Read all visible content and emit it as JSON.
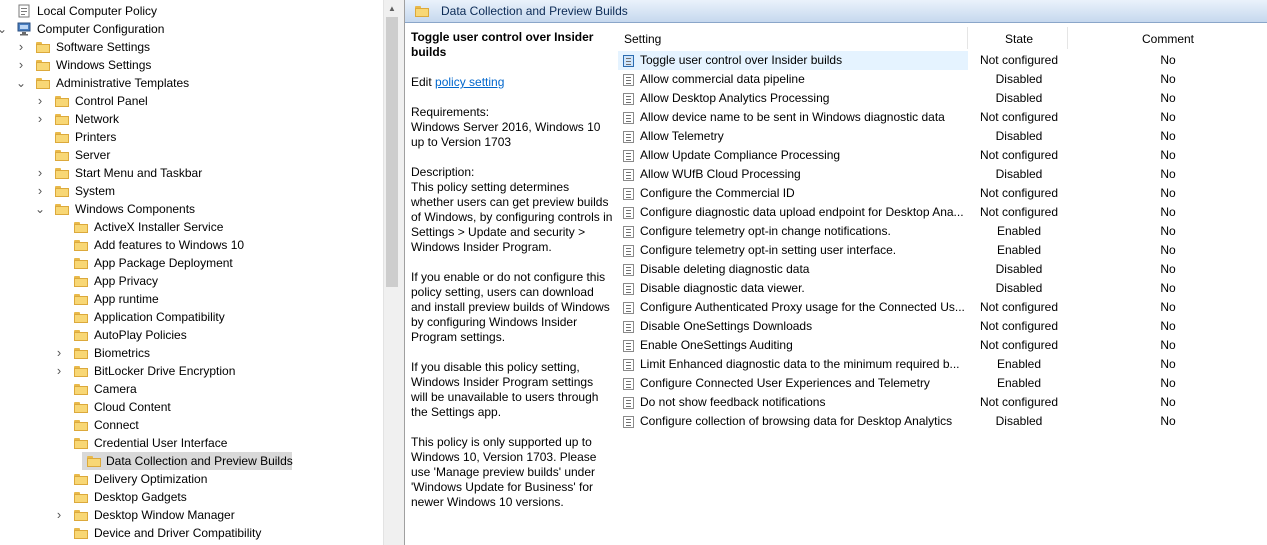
{
  "tree": {
    "items": [
      {
        "label": "Local Computer Policy",
        "level": 0,
        "expander": "none",
        "icon": "computer-policy-icon"
      },
      {
        "label": "Computer Configuration",
        "level": 0,
        "expander": "expanded",
        "icon": "computer-icon"
      },
      {
        "label": "Software Settings",
        "level": 1,
        "expander": "collapsed",
        "icon": "folder-icon"
      },
      {
        "label": "Windows Settings",
        "level": 1,
        "expander": "collapsed",
        "icon": "folder-icon"
      },
      {
        "label": "Administrative Templates",
        "level": 1,
        "expander": "expanded",
        "icon": "folder-icon"
      },
      {
        "label": "Control Panel",
        "level": 2,
        "expander": "collapsed",
        "icon": "folder-icon"
      },
      {
        "label": "Network",
        "level": 2,
        "expander": "collapsed",
        "icon": "folder-icon"
      },
      {
        "label": "Printers",
        "level": 2,
        "expander": "none",
        "icon": "folder-icon"
      },
      {
        "label": "Server",
        "level": 2,
        "expander": "none",
        "icon": "folder-icon"
      },
      {
        "label": "Start Menu and Taskbar",
        "level": 2,
        "expander": "collapsed",
        "icon": "folder-icon"
      },
      {
        "label": "System",
        "level": 2,
        "expander": "collapsed",
        "icon": "folder-icon"
      },
      {
        "label": "Windows Components",
        "level": 2,
        "expander": "expanded",
        "icon": "folder-icon"
      },
      {
        "label": "ActiveX Installer Service",
        "level": 3,
        "expander": "none",
        "icon": "folder-icon"
      },
      {
        "label": "Add features to Windows 10",
        "level": 3,
        "expander": "none",
        "icon": "folder-icon"
      },
      {
        "label": "App Package Deployment",
        "level": 3,
        "expander": "none",
        "icon": "folder-icon"
      },
      {
        "label": "App Privacy",
        "level": 3,
        "expander": "none",
        "icon": "folder-icon"
      },
      {
        "label": "App runtime",
        "level": 3,
        "expander": "none",
        "icon": "folder-icon"
      },
      {
        "label": "Application Compatibility",
        "level": 3,
        "expander": "none",
        "icon": "folder-icon"
      },
      {
        "label": "AutoPlay Policies",
        "level": 3,
        "expander": "none",
        "icon": "folder-icon"
      },
      {
        "label": "Biometrics",
        "level": 3,
        "expander": "collapsed",
        "icon": "folder-icon"
      },
      {
        "label": "BitLocker Drive Encryption",
        "level": 3,
        "expander": "collapsed",
        "icon": "folder-icon"
      },
      {
        "label": "Camera",
        "level": 3,
        "expander": "none",
        "icon": "folder-icon"
      },
      {
        "label": "Cloud Content",
        "level": 3,
        "expander": "none",
        "icon": "folder-icon"
      },
      {
        "label": "Connect",
        "level": 3,
        "expander": "none",
        "icon": "folder-icon"
      },
      {
        "label": "Credential User Interface",
        "level": 3,
        "expander": "none",
        "icon": "folder-icon"
      },
      {
        "label": "Data Collection and Preview Builds",
        "level": 3,
        "expander": "none",
        "icon": "folder-icon",
        "selected": true
      },
      {
        "label": "Delivery Optimization",
        "level": 3,
        "expander": "none",
        "icon": "folder-icon"
      },
      {
        "label": "Desktop Gadgets",
        "level": 3,
        "expander": "none",
        "icon": "folder-icon"
      },
      {
        "label": "Desktop Window Manager",
        "level": 3,
        "expander": "collapsed",
        "icon": "folder-icon"
      },
      {
        "label": "Device and Driver Compatibility",
        "level": 3,
        "expander": "none",
        "icon": "folder-icon"
      }
    ]
  },
  "header": {
    "title": "Data Collection and Preview Builds"
  },
  "description": {
    "title": "Toggle user control over Insider builds",
    "edit_prefix": "Edit ",
    "edit_link": "policy setting ",
    "requirements_label": "Requirements:",
    "requirements_text": "Windows Server 2016, Windows 10 up to Version 1703",
    "description_label": "Description:",
    "description_text": "This policy setting determines whether users can get preview builds of Windows, by configuring controls in Settings > Update and security > Windows Insider Program.",
    "enable_text": "If you enable or do not configure this policy setting, users can download and install preview builds of Windows by configuring Windows Insider Program settings.",
    "disable_text": "If you disable this policy setting, Windows Insider Program settings will be unavailable to users through the Settings app.",
    "support_text": "This policy is only supported up to Windows 10, Version 1703. Please use 'Manage preview builds' under 'Windows Update for Business' for newer Windows 10 versions."
  },
  "grid": {
    "columns": {
      "setting": "Setting",
      "state": "State",
      "comment": "Comment"
    },
    "rows": [
      {
        "name": "Toggle user control over Insider builds",
        "state": "Not configured",
        "comment": "No",
        "selected": true
      },
      {
        "name": "Allow commercial data pipeline",
        "state": "Disabled",
        "comment": "No"
      },
      {
        "name": "Allow Desktop Analytics Processing",
        "state": "Disabled",
        "comment": "No"
      },
      {
        "name": "Allow device name to be sent in Windows diagnostic data",
        "state": "Not configured",
        "comment": "No"
      },
      {
        "name": "Allow Telemetry",
        "state": "Disabled",
        "comment": "No"
      },
      {
        "name": "Allow Update Compliance Processing",
        "state": "Not configured",
        "comment": "No"
      },
      {
        "name": "Allow WUfB Cloud Processing",
        "state": "Disabled",
        "comment": "No"
      },
      {
        "name": "Configure the Commercial ID",
        "state": "Not configured",
        "comment": "No"
      },
      {
        "name": "Configure diagnostic data upload endpoint for Desktop Ana...",
        "state": "Not configured",
        "comment": "No"
      },
      {
        "name": "Configure telemetry opt-in change notifications.",
        "state": "Enabled",
        "comment": "No"
      },
      {
        "name": "Configure telemetry opt-in setting user interface.",
        "state": "Enabled",
        "comment": "No"
      },
      {
        "name": "Disable deleting diagnostic data",
        "state": "Disabled",
        "comment": "No"
      },
      {
        "name": "Disable diagnostic data viewer.",
        "state": "Disabled",
        "comment": "No"
      },
      {
        "name": "Configure Authenticated Proxy usage for the Connected Us...",
        "state": "Not configured",
        "comment": "No"
      },
      {
        "name": "Disable OneSettings Downloads",
        "state": "Not configured",
        "comment": "No"
      },
      {
        "name": "Enable OneSettings Auditing",
        "state": "Not configured",
        "comment": "No"
      },
      {
        "name": "Limit Enhanced diagnostic data to the minimum required b...",
        "state": "Enabled",
        "comment": "No"
      },
      {
        "name": "Configure Connected User Experiences and Telemetry",
        "state": "Enabled",
        "comment": "No"
      },
      {
        "name": "Do not show feedback notifications",
        "state": "Not configured",
        "comment": "No"
      },
      {
        "name": "Configure collection of browsing data for Desktop Analytics",
        "state": "Disabled",
        "comment": "No"
      }
    ]
  }
}
